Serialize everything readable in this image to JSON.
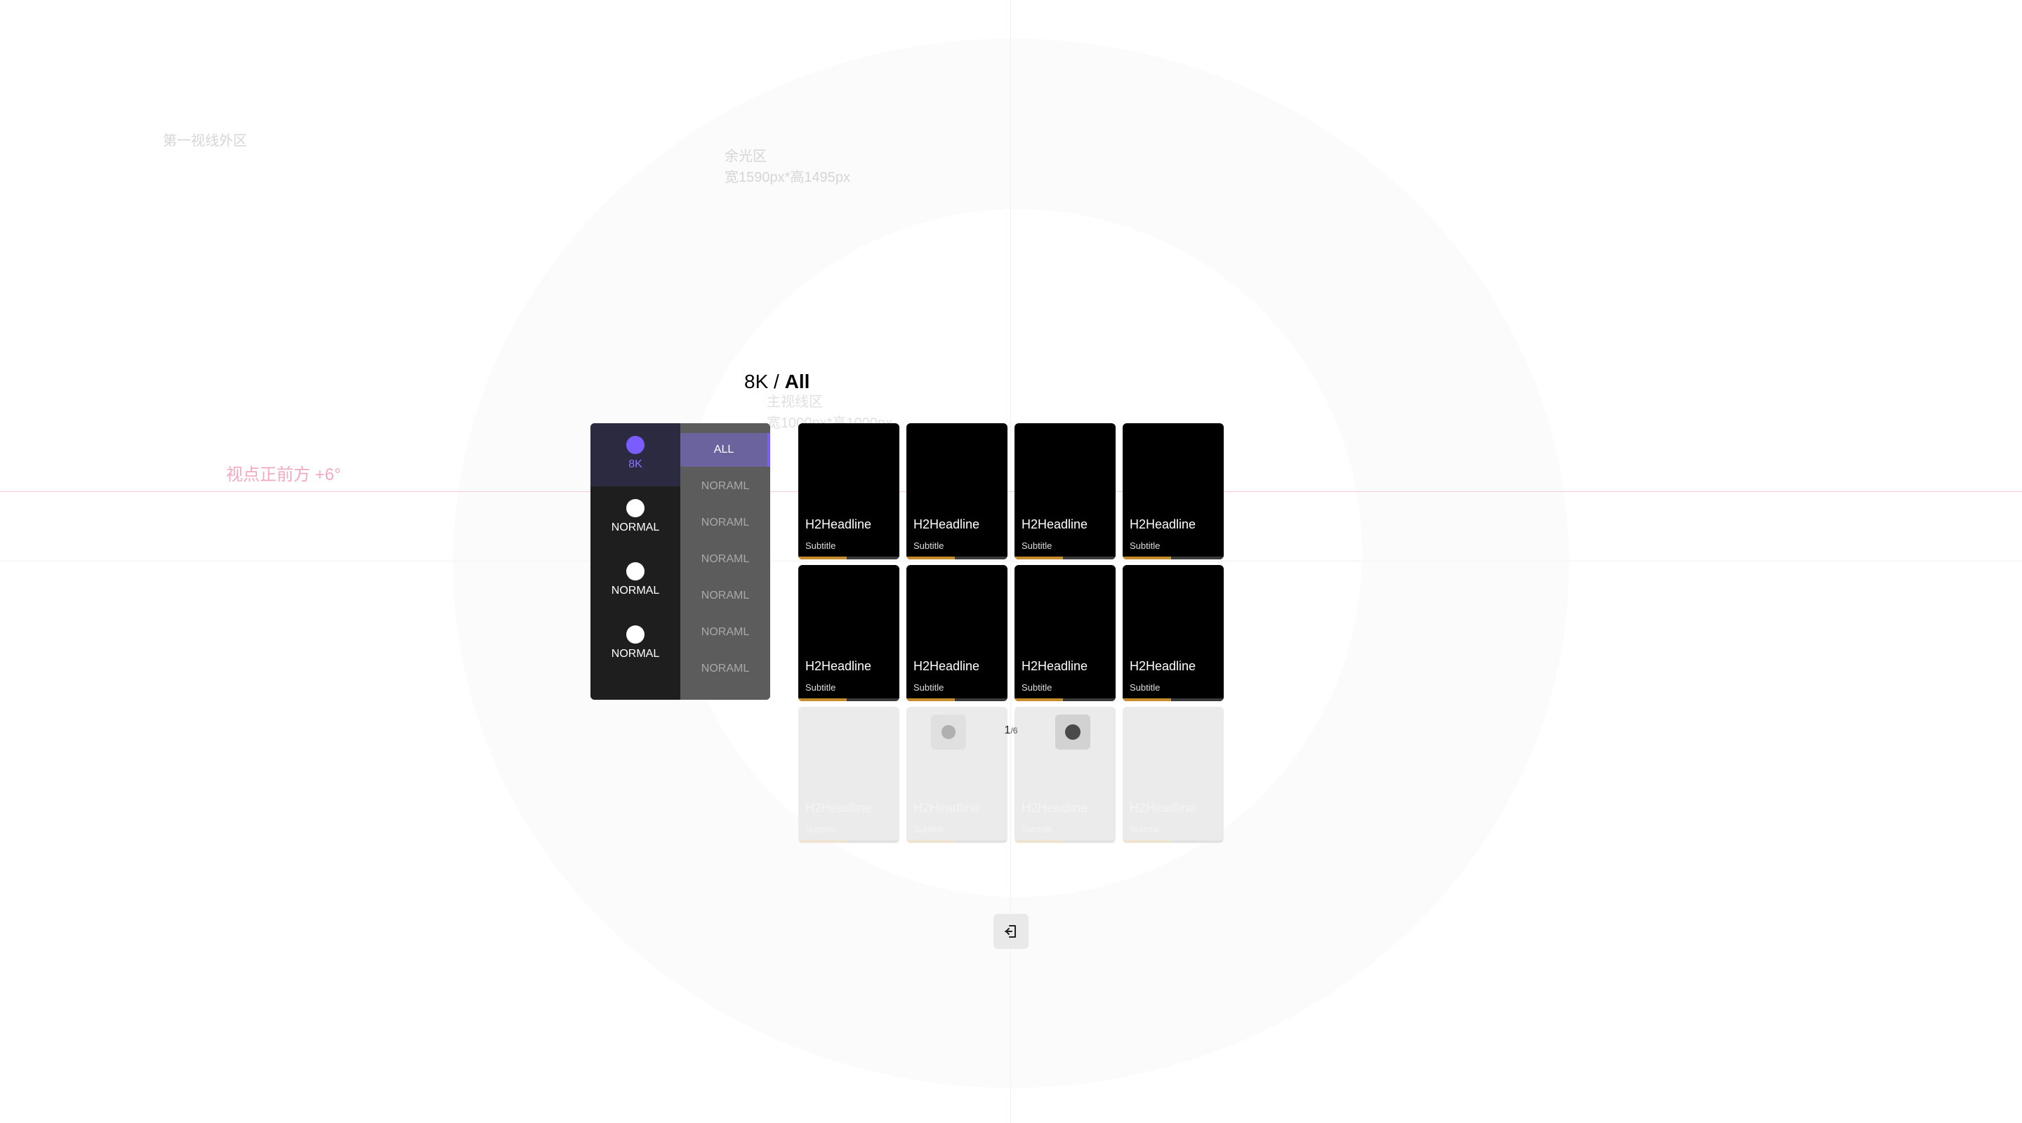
{
  "annotations": {
    "outside_first_view": "第一视线外区",
    "peripheral_title": "余光区",
    "peripheral_size": "宽1590px*高1495px",
    "main_view_title": "主视线区",
    "main_view_size": "宽1000px*高1000px",
    "horizon_label": "视点正前方 +6°"
  },
  "heading": {
    "prefix": "8K / ",
    "current": "All"
  },
  "rail": {
    "items": [
      {
        "label": "8K",
        "active": true
      },
      {
        "label": "NORMAL",
        "active": false
      },
      {
        "label": "NORMAL",
        "active": false
      },
      {
        "label": "NORMAL",
        "active": false
      }
    ]
  },
  "sublist": {
    "items": [
      {
        "label": "ALL",
        "active": true
      },
      {
        "label": "NORAML"
      },
      {
        "label": "NORAML"
      },
      {
        "label": "NORAML"
      },
      {
        "label": "NORAML"
      },
      {
        "label": "NORAML"
      },
      {
        "label": "NORAML"
      }
    ]
  },
  "cards": [
    {
      "headline": "H2Headline",
      "subtitle": "Subtitle",
      "progress": 0.48
    },
    {
      "headline": "H2Headline",
      "subtitle": "Subtitle",
      "progress": 0.48
    },
    {
      "headline": "H2Headline",
      "subtitle": "Subtitle",
      "progress": 0.48
    },
    {
      "headline": "H2Headline",
      "subtitle": "Subtitle",
      "progress": 0.48
    },
    {
      "headline": "H2Headline",
      "subtitle": "Subtitle",
      "progress": 0.48
    },
    {
      "headline": "H2Headline",
      "subtitle": "Subtitle",
      "progress": 0.48
    },
    {
      "headline": "H2Headline",
      "subtitle": "Subtitle",
      "progress": 0.48
    },
    {
      "headline": "H2Headline",
      "subtitle": "Subtitle",
      "progress": 0.48
    },
    {
      "headline": "H2Headline",
      "subtitle": "Subtitle",
      "progress": 0.48
    },
    {
      "headline": "H2Headline",
      "subtitle": "Subtitle",
      "progress": 0.48
    },
    {
      "headline": "H2Headline",
      "subtitle": "Subtitle",
      "progress": 0.48
    },
    {
      "headline": "H2Headline",
      "subtitle": "Subtitle",
      "progress": 0.48
    }
  ],
  "pager": {
    "current": "1",
    "total": "/6"
  },
  "exit": {
    "icon": "exit-icon"
  }
}
